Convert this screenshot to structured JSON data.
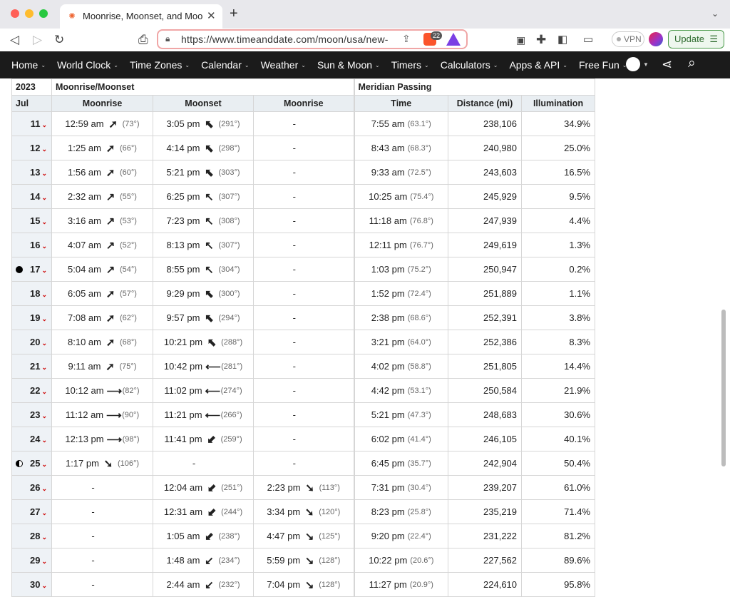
{
  "browser": {
    "tab_title": "Moonrise, Moonset, and Moon P",
    "url": "https://www.timeanddate.com/moon/usa/new-...",
    "vpn_label": "VPN",
    "update_label": "Update",
    "shield_count": "22"
  },
  "nav": {
    "items": [
      "Home",
      "World Clock",
      "Time Zones",
      "Calendar",
      "Weather",
      "Sun & Moon",
      "Timers",
      "Calculators",
      "Apps & API",
      "Free Fun"
    ]
  },
  "table": {
    "year": "2023",
    "group_moon": "Moonrise/Moonset",
    "group_meridian": "Meridian Passing",
    "month": "Jul",
    "col_moonrise": "Moonrise",
    "col_moonset": "Moonset",
    "col_moonrise2": "Moonrise",
    "col_time": "Time",
    "col_distance": "Distance (mi)",
    "col_illum": "Illumination",
    "rows": [
      {
        "day": "11",
        "rise": "12:59 am",
        "rise_arrow": "➚",
        "rise_deg": "(73°)",
        "set": "3:05 pm",
        "set_arrow": "⬉",
        "set_deg": "(291°)",
        "rise2": "-",
        "rise2_arrow": "",
        "rise2_deg": "",
        "mer": "7:55 am",
        "mer_deg": "(63.1°)",
        "dist": "238,106",
        "illum": "34.9%",
        "phase": ""
      },
      {
        "day": "12",
        "rise": "1:25 am",
        "rise_arrow": "➚",
        "rise_deg": "(66°)",
        "set": "4:14 pm",
        "set_arrow": "⬉",
        "set_deg": "(298°)",
        "rise2": "-",
        "rise2_arrow": "",
        "rise2_deg": "",
        "mer": "8:43 am",
        "mer_deg": "(68.3°)",
        "dist": "240,980",
        "illum": "25.0%",
        "phase": ""
      },
      {
        "day": "13",
        "rise": "1:56 am",
        "rise_arrow": "➚",
        "rise_deg": "(60°)",
        "set": "5:21 pm",
        "set_arrow": "⬉",
        "set_deg": "(303°)",
        "rise2": "-",
        "rise2_arrow": "",
        "rise2_deg": "",
        "mer": "9:33 am",
        "mer_deg": "(72.5°)",
        "dist": "243,603",
        "illum": "16.5%",
        "phase": ""
      },
      {
        "day": "14",
        "rise": "2:32 am",
        "rise_arrow": "↗",
        "rise_deg": "(55°)",
        "set": "6:25 pm",
        "set_arrow": "↖",
        "set_deg": "(307°)",
        "rise2": "-",
        "rise2_arrow": "",
        "rise2_deg": "",
        "mer": "10:25 am",
        "mer_deg": "(75.4°)",
        "dist": "245,929",
        "illum": "9.5%",
        "phase": ""
      },
      {
        "day": "15",
        "rise": "3:16 am",
        "rise_arrow": "↗",
        "rise_deg": "(53°)",
        "set": "7:23 pm",
        "set_arrow": "↖",
        "set_deg": "(308°)",
        "rise2": "-",
        "rise2_arrow": "",
        "rise2_deg": "",
        "mer": "11:18 am",
        "mer_deg": "(76.8°)",
        "dist": "247,939",
        "illum": "4.4%",
        "phase": ""
      },
      {
        "day": "16",
        "rise": "4:07 am",
        "rise_arrow": "↗",
        "rise_deg": "(52°)",
        "set": "8:13 pm",
        "set_arrow": "↖",
        "set_deg": "(307°)",
        "rise2": "-",
        "rise2_arrow": "",
        "rise2_deg": "",
        "mer": "12:11 pm",
        "mer_deg": "(76.7°)",
        "dist": "249,619",
        "illum": "1.3%",
        "phase": ""
      },
      {
        "day": "17",
        "rise": "5:04 am",
        "rise_arrow": "↗",
        "rise_deg": "(54°)",
        "set": "8:55 pm",
        "set_arrow": "↖",
        "set_deg": "(304°)",
        "rise2": "-",
        "rise2_arrow": "",
        "rise2_deg": "",
        "mer": "1:03 pm",
        "mer_deg": "(75.2°)",
        "dist": "250,947",
        "illum": "0.2%",
        "phase": "new"
      },
      {
        "day": "18",
        "rise": "6:05 am",
        "rise_arrow": "➚",
        "rise_deg": "(57°)",
        "set": "9:29 pm",
        "set_arrow": "⬉",
        "set_deg": "(300°)",
        "rise2": "-",
        "rise2_arrow": "",
        "rise2_deg": "",
        "mer": "1:52 pm",
        "mer_deg": "(72.4°)",
        "dist": "251,889",
        "illum": "1.1%",
        "phase": ""
      },
      {
        "day": "19",
        "rise": "7:08 am",
        "rise_arrow": "➚",
        "rise_deg": "(62°)",
        "set": "9:57 pm",
        "set_arrow": "⬉",
        "set_deg": "(294°)",
        "rise2": "-",
        "rise2_arrow": "",
        "rise2_deg": "",
        "mer": "2:38 pm",
        "mer_deg": "(68.6°)",
        "dist": "252,391",
        "illum": "3.8%",
        "phase": ""
      },
      {
        "day": "20",
        "rise": "8:10 am",
        "rise_arrow": "➚",
        "rise_deg": "(68°)",
        "set": "10:21 pm",
        "set_arrow": "⬉",
        "set_deg": "(288°)",
        "rise2": "-",
        "rise2_arrow": "",
        "rise2_deg": "",
        "mer": "3:21 pm",
        "mer_deg": "(64.0°)",
        "dist": "252,386",
        "illum": "8.3%",
        "phase": ""
      },
      {
        "day": "21",
        "rise": "9:11 am",
        "rise_arrow": "➚",
        "rise_deg": "(75°)",
        "set": "10:42 pm",
        "set_arrow": "⟵",
        "set_deg": "(281°)",
        "rise2": "-",
        "rise2_arrow": "",
        "rise2_deg": "",
        "mer": "4:02 pm",
        "mer_deg": "(58.8°)",
        "dist": "251,805",
        "illum": "14.4%",
        "phase": ""
      },
      {
        "day": "22",
        "rise": "10:12 am",
        "rise_arrow": "⟶",
        "rise_deg": "(82°)",
        "set": "11:02 pm",
        "set_arrow": "⟵",
        "set_deg": "(274°)",
        "rise2": "-",
        "rise2_arrow": "",
        "rise2_deg": "",
        "mer": "4:42 pm",
        "mer_deg": "(53.1°)",
        "dist": "250,584",
        "illum": "21.9%",
        "phase": ""
      },
      {
        "day": "23",
        "rise": "11:12 am",
        "rise_arrow": "⟶",
        "rise_deg": "(90°)",
        "set": "11:21 pm",
        "set_arrow": "⟵",
        "set_deg": "(266°)",
        "rise2": "-",
        "rise2_arrow": "",
        "rise2_deg": "",
        "mer": "5:21 pm",
        "mer_deg": "(47.3°)",
        "dist": "248,683",
        "illum": "30.6%",
        "phase": ""
      },
      {
        "day": "24",
        "rise": "12:13 pm",
        "rise_arrow": "⟶",
        "rise_deg": "(98°)",
        "set": "11:41 pm",
        "set_arrow": "⬋",
        "set_deg": "(259°)",
        "rise2": "-",
        "rise2_arrow": "",
        "rise2_deg": "",
        "mer": "6:02 pm",
        "mer_deg": "(41.4°)",
        "dist": "246,105",
        "illum": "40.1%",
        "phase": ""
      },
      {
        "day": "25",
        "rise": "1:17 pm",
        "rise_arrow": "➘",
        "rise_deg": "(106°)",
        "set": "-",
        "set_arrow": "",
        "set_deg": "",
        "rise2": "-",
        "rise2_arrow": "",
        "rise2_deg": "",
        "mer": "6:45 pm",
        "mer_deg": "(35.7°)",
        "dist": "242,904",
        "illum": "50.4%",
        "phase": "first"
      },
      {
        "day": "26",
        "rise": "-",
        "rise_arrow": "",
        "rise_deg": "",
        "set": "12:04 am",
        "set_arrow": "⬋",
        "set_deg": "(251°)",
        "rise2": "2:23 pm",
        "rise2_arrow": "➘",
        "rise2_deg": "(113°)",
        "mer": "7:31 pm",
        "mer_deg": "(30.4°)",
        "dist": "239,207",
        "illum": "61.0%",
        "phase": ""
      },
      {
        "day": "27",
        "rise": "-",
        "rise_arrow": "",
        "rise_deg": "",
        "set": "12:31 am",
        "set_arrow": "⬋",
        "set_deg": "(244°)",
        "rise2": "3:34 pm",
        "rise2_arrow": "➘",
        "rise2_deg": "(120°)",
        "mer": "8:23 pm",
        "mer_deg": "(25.8°)",
        "dist": "235,219",
        "illum": "71.4%",
        "phase": ""
      },
      {
        "day": "28",
        "rise": "-",
        "rise_arrow": "",
        "rise_deg": "",
        "set": "1:05 am",
        "set_arrow": "⬋",
        "set_deg": "(238°)",
        "rise2": "4:47 pm",
        "rise2_arrow": "↘",
        "rise2_deg": "(125°)",
        "mer": "9:20 pm",
        "mer_deg": "(22.4°)",
        "dist": "231,222",
        "illum": "81.2%",
        "phase": ""
      },
      {
        "day": "29",
        "rise": "-",
        "rise_arrow": "",
        "rise_deg": "",
        "set": "1:48 am",
        "set_arrow": "↙",
        "set_deg": "(234°)",
        "rise2": "5:59 pm",
        "rise2_arrow": "↘",
        "rise2_deg": "(128°)",
        "mer": "10:22 pm",
        "mer_deg": "(20.6°)",
        "dist": "227,562",
        "illum": "89.6%",
        "phase": ""
      },
      {
        "day": "30",
        "rise": "-",
        "rise_arrow": "",
        "rise_deg": "",
        "set": "2:44 am",
        "set_arrow": "↙",
        "set_deg": "(232°)",
        "rise2": "7:04 pm",
        "rise2_arrow": "↘",
        "rise2_deg": "(128°)",
        "mer": "11:27 pm",
        "mer_deg": "(20.9°)",
        "dist": "224,610",
        "illum": "95.8%",
        "phase": ""
      }
    ]
  }
}
